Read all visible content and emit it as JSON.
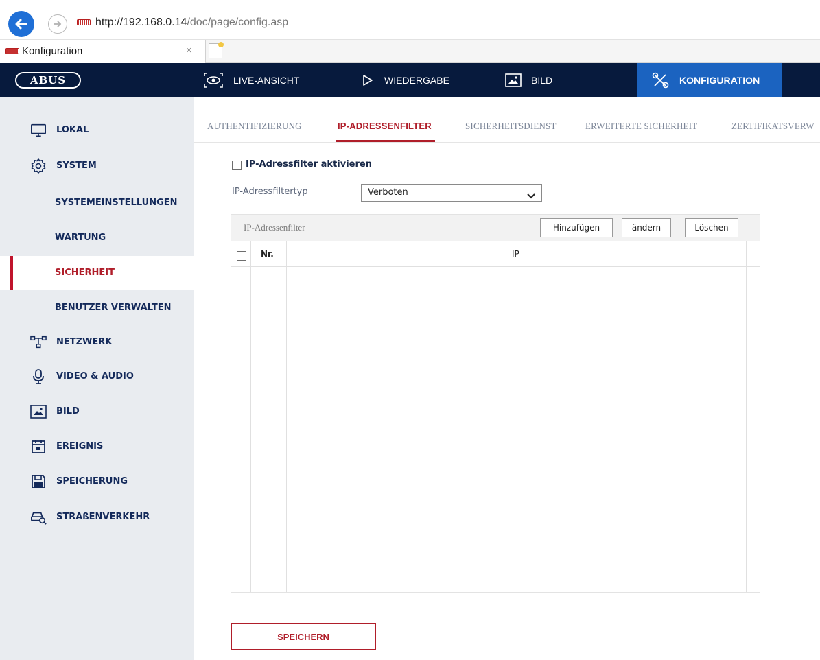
{
  "browser": {
    "url_host": "http://192.168.0.14",
    "url_path": "/doc/page/config.asp",
    "tab_title": "Konfiguration",
    "tab_close": "×"
  },
  "app": {
    "logo": "ABUS",
    "nav": [
      {
        "label": "LIVE-ANSICHT",
        "icon": "eye-camera-icon",
        "active": false
      },
      {
        "label": "WIEDERGABE",
        "icon": "play-icon",
        "active": false
      },
      {
        "label": "BILD",
        "icon": "image-icon",
        "active": false
      },
      {
        "label": "KONFIGURATION",
        "icon": "tools-icon",
        "active": true
      }
    ]
  },
  "sidebar": {
    "items": [
      {
        "label": "LOKAL",
        "icon": "monitor-icon"
      },
      {
        "label": "SYSTEM",
        "icon": "gear-icon"
      },
      {
        "label": "SYSTEMEINSTELLUNGEN",
        "sub": true
      },
      {
        "label": "WARTUNG",
        "sub": true
      },
      {
        "label": "SICHERHEIT",
        "sub": true,
        "active": true
      },
      {
        "label": "BENUTZER VERWALTEN",
        "sub": true
      },
      {
        "label": "NETZWERK",
        "icon": "network-icon"
      },
      {
        "label": "VIDEO & AUDIO",
        "icon": "microphone-icon"
      },
      {
        "label": "BILD",
        "icon": "image-icon"
      },
      {
        "label": "EREIGNIS",
        "icon": "calendar-icon"
      },
      {
        "label": "SPEICHERUNG",
        "icon": "floppy-disk-icon"
      },
      {
        "label": "STRAßENVERKEHR",
        "icon": "car-search-icon"
      }
    ]
  },
  "tabs": [
    {
      "label": "AUTHENTIFIZIERUNG",
      "active": false
    },
    {
      "label": "IP-ADRESSENFILTER",
      "active": true
    },
    {
      "label": "SICHERHEITSDIENST",
      "active": false
    },
    {
      "label": "ERWEITERTE SICHERHEIT",
      "active": false
    },
    {
      "label": "ZERTIFIKATSVERW",
      "active": false
    }
  ],
  "form": {
    "enable_label": "IP-Adressfilter aktivieren",
    "enable_checked": false,
    "type_label": "IP-Adressfiltertyp",
    "type_value": "Verboten"
  },
  "table": {
    "title": "IP-Adressenfilter",
    "buttons": {
      "add": "Hinzufügen",
      "edit": "ändern",
      "delete": "Löschen"
    },
    "columns": {
      "nr": "Nr.",
      "ip": "IP"
    },
    "rows": []
  },
  "save_button": "SPEICHERN",
  "colors": {
    "nav_bg": "#071a3d",
    "nav_active": "#1b63c0",
    "accent_red": "#b01e2a",
    "sidebar_bg": "#e9ecf0"
  }
}
